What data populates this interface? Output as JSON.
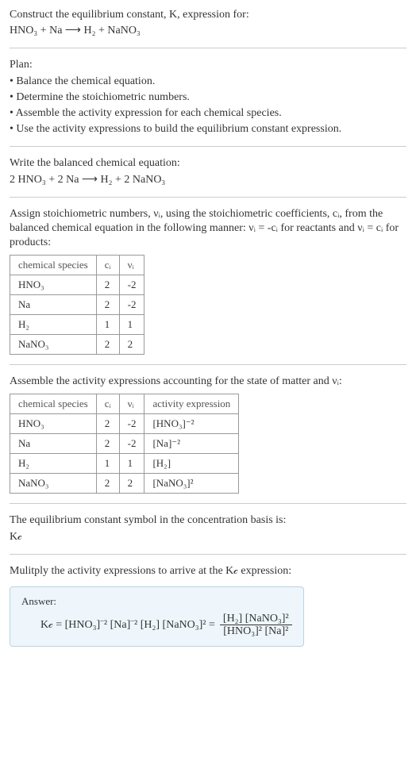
{
  "intro": {
    "line1": "Construct the equilibrium constant, K, expression for:",
    "line2": "HNO₃ + Na ⟶ H₂ + NaNO₃"
  },
  "plan": {
    "header": "Plan:",
    "b1": "• Balance the chemical equation.",
    "b2": "• Determine the stoichiometric numbers.",
    "b3": "• Assemble the activity expression for each chemical species.",
    "b4": "• Use the activity expressions to build the equilibrium constant expression."
  },
  "balanced": {
    "line1": "Write the balanced chemical equation:",
    "line2": "2 HNO₃ + 2 Na ⟶ H₂ + 2 NaNO₃"
  },
  "stoich": {
    "text": "Assign stoichiometric numbers, νᵢ, using the stoichiometric coefficients, cᵢ, from the balanced chemical equation in the following manner: νᵢ = -cᵢ for reactants and νᵢ = cᵢ for products:",
    "headers": {
      "h1": "chemical species",
      "h2": "cᵢ",
      "h3": "νᵢ"
    },
    "rows": [
      {
        "sp": "HNO₃",
        "c": "2",
        "v": "-2"
      },
      {
        "sp": "Na",
        "c": "2",
        "v": "-2"
      },
      {
        "sp": "H₂",
        "c": "1",
        "v": "1"
      },
      {
        "sp": "NaNO₃",
        "c": "2",
        "v": "2"
      }
    ]
  },
  "activity": {
    "text": "Assemble the activity expressions accounting for the state of matter and νᵢ:",
    "headers": {
      "h1": "chemical species",
      "h2": "cᵢ",
      "h3": "νᵢ",
      "h4": "activity expression"
    },
    "rows": [
      {
        "sp": "HNO₃",
        "c": "2",
        "v": "-2",
        "a": "[HNO₃]⁻²"
      },
      {
        "sp": "Na",
        "c": "2",
        "v": "-2",
        "a": "[Na]⁻²"
      },
      {
        "sp": "H₂",
        "c": "1",
        "v": "1",
        "a": "[H₂]"
      },
      {
        "sp": "NaNO₃",
        "c": "2",
        "v": "2",
        "a": "[NaNO₃]²"
      }
    ]
  },
  "symbol": {
    "line1": "The equilibrium constant symbol in the concentration basis is:",
    "line2": "K𝒸"
  },
  "multiply": {
    "text": "Mulitply the activity expressions to arrive at the K𝒸 expression:"
  },
  "answer": {
    "label": "Answer:",
    "lhs": "K𝒸 = [HNO₃]⁻² [Na]⁻² [H₂] [NaNO₃]² =",
    "num": "[H₂] [NaNO₃]²",
    "den": "[HNO₃]² [Na]²"
  }
}
